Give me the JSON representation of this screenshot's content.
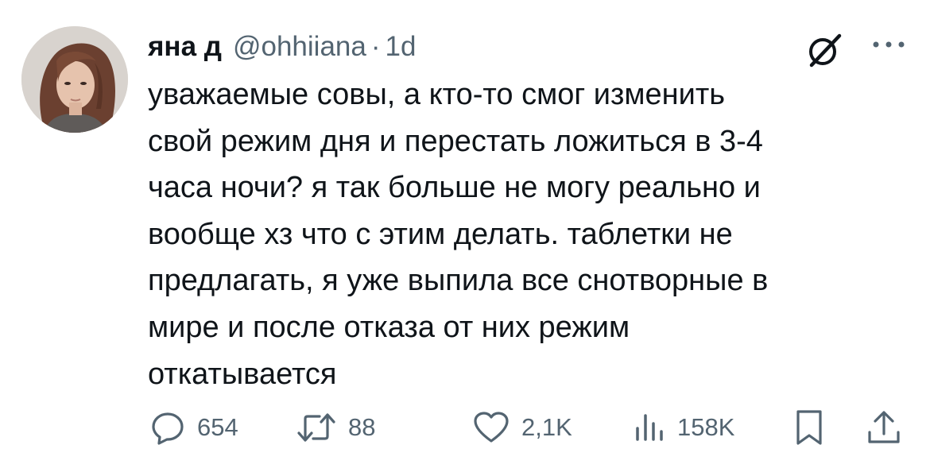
{
  "tweet": {
    "author": {
      "name": "яна д",
      "handle": "@ohhiiana",
      "separator": "·",
      "time": "1d"
    },
    "text_lines": [
      "уважаемые совы, а кто-то смог изменить",
      "свой режим дня и перестать ложиться в 3-4",
      "часа ночи? я так больше не могу реально и",
      "вообще хз что с этим делать. таблетки не",
      "предлагать, я уже выпила все снотворные в",
      "мире и после отказа от них режим",
      "откатывается"
    ],
    "stats": {
      "replies": "654",
      "retweets": "88",
      "likes": "2,1K",
      "views": "158K"
    }
  },
  "icons": {
    "grok": "grok-icon",
    "more": "more-icon",
    "reply": "reply-icon",
    "retweet": "retweet-icon",
    "like": "heart-icon",
    "views": "views-icon",
    "bookmark": "bookmark-icon",
    "share": "share-icon"
  },
  "colors": {
    "text": "#0f1419",
    "secondary": "#536471",
    "background": "#ffffff"
  }
}
